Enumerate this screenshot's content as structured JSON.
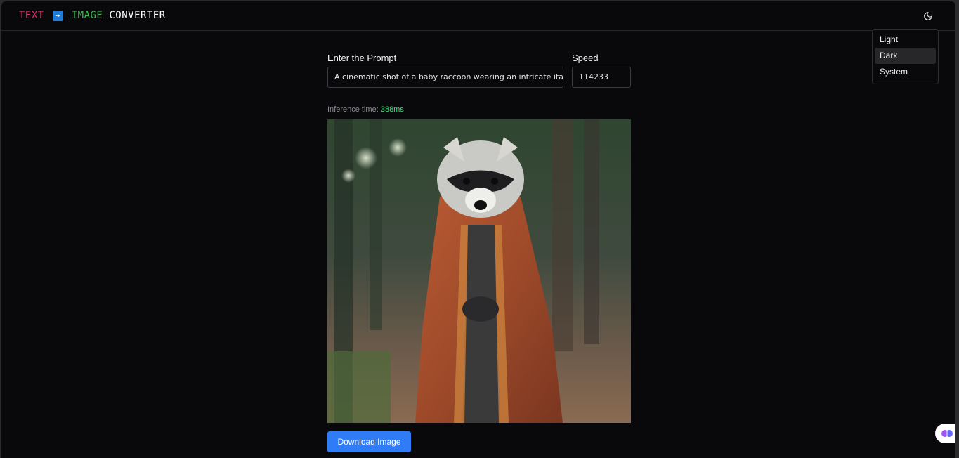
{
  "header": {
    "logo_word1": "TEXT",
    "logo_arrow": "→",
    "logo_word2": "IMAGE",
    "logo_word3": "CONVERTER",
    "theme_icon": "moon-icon"
  },
  "theme_menu": {
    "items": [
      {
        "label": "Light",
        "active": false
      },
      {
        "label": "Dark",
        "active": true
      },
      {
        "label": "System",
        "active": false
      }
    ]
  },
  "form": {
    "prompt_label": "Enter the Prompt",
    "prompt_value": "A cinematic shot of a baby raccoon wearing an intricate italian",
    "speed_label": "Speed",
    "speed_value": "114233"
  },
  "result": {
    "inference_label": "Inference time:",
    "inference_value": "388ms",
    "image_subject": "raccoon-in-embroidered-cloak-image",
    "download_label": "Download Image"
  },
  "colors": {
    "background": "#09090b",
    "accent": "#2f7cf6",
    "logo_text": "#e0316b",
    "logo_image": "#3fb950",
    "inference_value": "#4ade80"
  }
}
